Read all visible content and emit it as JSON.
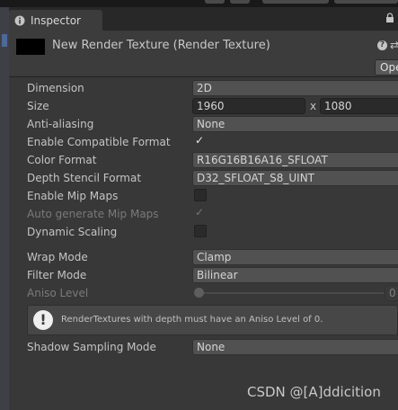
{
  "window": {
    "tab_label": "Inspector"
  },
  "header": {
    "title": "New Render Texture (Render Texture)",
    "open_label": "Ope"
  },
  "properties": {
    "dimension": {
      "label": "Dimension",
      "value": "2D"
    },
    "size": {
      "label": "Size",
      "width": "1960",
      "separator": "x",
      "height": "1080"
    },
    "anti_aliasing": {
      "label": "Anti-aliasing",
      "value": "None"
    },
    "enable_compatible_format": {
      "label": "Enable Compatible Format",
      "checked": true
    },
    "color_format": {
      "label": "Color Format",
      "value": "R16G16B16A16_SFLOAT"
    },
    "depth_stencil_format": {
      "label": "Depth Stencil Format",
      "value": "D32_SFLOAT_S8_UINT"
    },
    "enable_mip_maps": {
      "label": "Enable Mip Maps",
      "checked": false
    },
    "auto_generate_mip_maps": {
      "label": "Auto generate Mip Maps",
      "checked": true,
      "disabled": true
    },
    "dynamic_scaling": {
      "label": "Dynamic Scaling",
      "checked": false
    },
    "wrap_mode": {
      "label": "Wrap Mode",
      "value": "Clamp"
    },
    "filter_mode": {
      "label": "Filter Mode",
      "value": "Bilinear"
    },
    "aniso_level": {
      "label": "Aniso Level",
      "value": "0",
      "disabled": true
    },
    "shadow_sampling_mode": {
      "label": "Shadow Sampling Mode",
      "value": "None"
    }
  },
  "help_box": {
    "icon": "exclamation-icon",
    "text": "RenderTextures with depth must have an Aniso Level of 0."
  },
  "watermark": "CSDN @[A]ddicition",
  "colors": {
    "panel_bg": "#383838",
    "field_bg": "#515151",
    "input_bg": "#2a2a2a",
    "text": "#c4c4c4",
    "disabled_text": "#7a7a7a"
  }
}
